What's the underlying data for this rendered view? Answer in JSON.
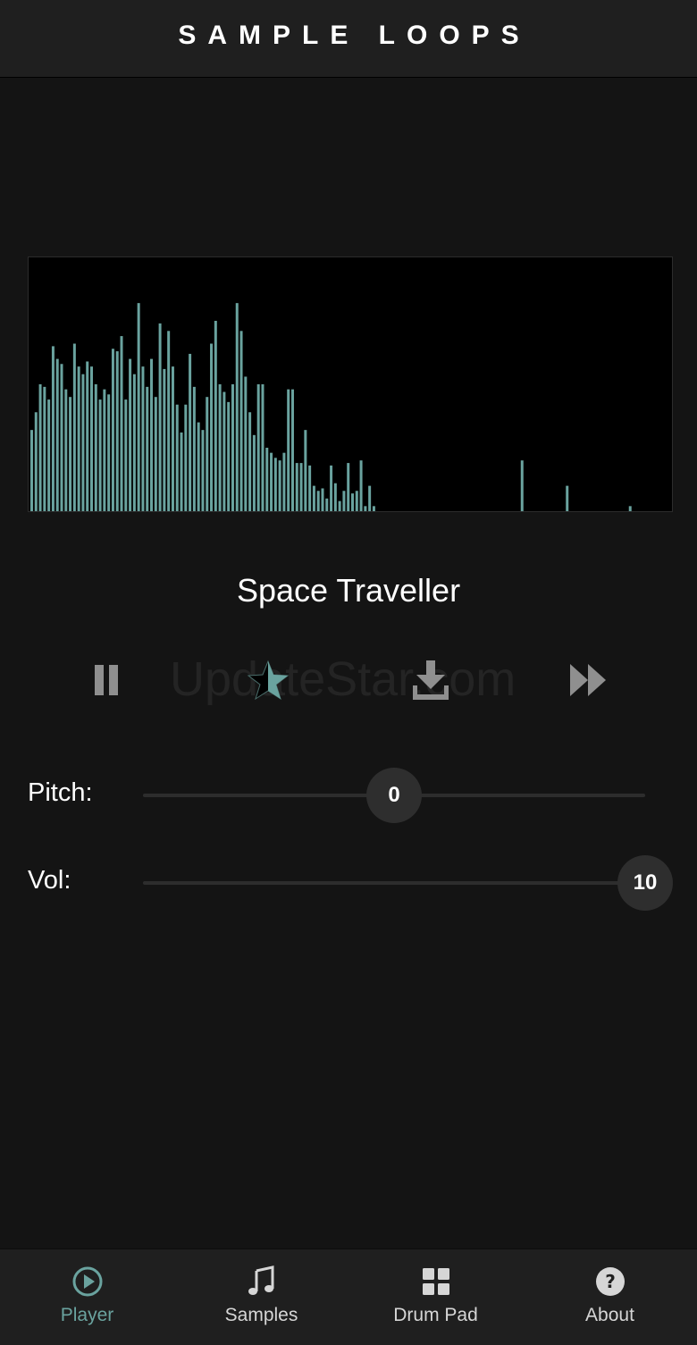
{
  "header": {
    "title": "SAMPLE LOOPS"
  },
  "visualizer": {
    "bar_color": "#6aa39f",
    "levels": [
      0.32,
      0.39,
      0.5,
      0.49,
      0.44,
      0.65,
      0.6,
      0.58,
      0.48,
      0.45,
      0.66,
      0.57,
      0.54,
      0.59,
      0.57,
      0.5,
      0.44,
      0.48,
      0.46,
      0.64,
      0.63,
      0.69,
      0.44,
      0.6,
      0.54,
      0.82,
      0.57,
      0.49,
      0.6,
      0.45,
      0.74,
      0.56,
      0.71,
      0.57,
      0.42,
      0.31,
      0.42,
      0.62,
      0.49,
      0.35,
      0.32,
      0.45,
      0.66,
      0.75,
      0.5,
      0.47,
      0.43,
      0.5,
      0.82,
      0.71,
      0.53,
      0.39,
      0.3,
      0.5,
      0.5,
      0.25,
      0.23,
      0.21,
      0.2,
      0.23,
      0.48,
      0.48,
      0.19,
      0.19,
      0.32,
      0.18,
      0.1,
      0.08,
      0.09,
      0.05,
      0.18,
      0.11,
      0.04,
      0.08,
      0.19,
      0.07,
      0.08,
      0.2,
      0.02,
      0.1,
      0.02
    ],
    "markers": [
      {
        "x": 0.765,
        "level": 0.2
      },
      {
        "x": 0.835,
        "level": 0.1
      },
      {
        "x": 0.933,
        "level": 0.02
      }
    ]
  },
  "track": {
    "title": "Space Traveller"
  },
  "controls": {
    "watermark": "UpdateStar.com",
    "pause_icon": "pause-icon",
    "favorite_icon": "star-icon",
    "download_icon": "download-icon",
    "next_icon": "fast-forward-icon",
    "accent_color": "#6aa39f",
    "icon_color": "#8f8f8f"
  },
  "sliders": {
    "pitch": {
      "label": "Pitch:",
      "value": "0",
      "level": 0.5
    },
    "volume": {
      "label": "Vol:",
      "value": "10",
      "level": 1.0
    }
  },
  "nav": {
    "active_color": "#6aa39f",
    "inactive_color": "#d6d6d6",
    "items": [
      {
        "label": "Player",
        "icon": "play-circle-icon",
        "active": true
      },
      {
        "label": "Samples",
        "icon": "music-note-icon",
        "active": false
      },
      {
        "label": "Drum Pad",
        "icon": "grid-icon",
        "active": false
      },
      {
        "label": "About",
        "icon": "help-circle-icon",
        "active": false
      }
    ]
  }
}
